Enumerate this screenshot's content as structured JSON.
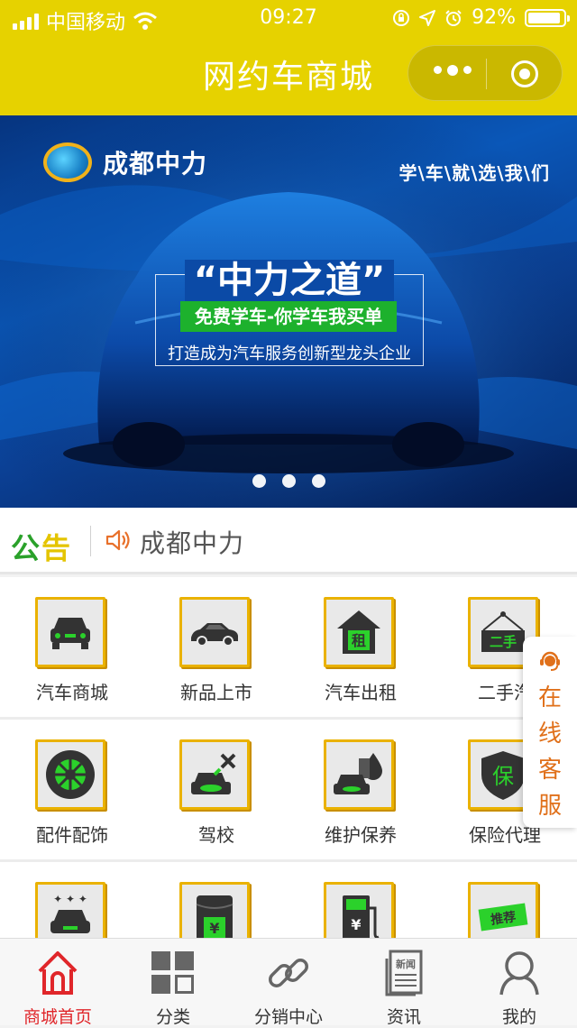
{
  "status_bar": {
    "carrier": "中国移动",
    "time": "09:27",
    "battery": "92%",
    "battery_level": 0.92
  },
  "header": {
    "title": "网约车商城",
    "more_icon": "ellipsis-icon",
    "close_icon": "target-icon"
  },
  "banner": {
    "brand": "成都中力",
    "slogan": "学\\车\\就\\选\\我\\们",
    "headline": "“中力之道”",
    "tagline": "免费学车-你学车我买单",
    "subline": "打造成为汽车服务创新型龙头企业",
    "page_count": 3,
    "active_page": 0
  },
  "notice": {
    "tag_part1": "公",
    "tag_part2": "告",
    "text": "成都中力"
  },
  "categories": [
    {
      "label": "汽车商城",
      "icon": "car-front-icon"
    },
    {
      "label": "新品上市",
      "icon": "sedan-icon"
    },
    {
      "label": "汽车出租",
      "icon": "rent-house-icon",
      "glyph": "租"
    },
    {
      "label": "二手汽",
      "icon": "secondhand-sign-icon",
      "glyph": "二手"
    },
    {
      "label": "配件配饰",
      "icon": "wheel-icon"
    },
    {
      "label": "驾校",
      "icon": "car-repair-icon"
    },
    {
      "label": "维护保养",
      "icon": "oil-drop-car-icon"
    },
    {
      "label": "保险代理",
      "icon": "shield-icon",
      "glyph": "保"
    },
    {
      "label": "",
      "icon": "car-sparkle-icon"
    },
    {
      "label": "",
      "icon": "wallet-yuan-icon",
      "glyph": "¥"
    },
    {
      "label": "",
      "icon": "fuel-pump-icon",
      "glyph": "¥"
    },
    {
      "label": "",
      "icon": "recommend-stamp-icon",
      "glyph": "推荐"
    }
  ],
  "service": {
    "text": "在线客服",
    "icon": "headset-icon",
    "color": "#e0701a"
  },
  "tabbar": [
    {
      "label": "商城首页",
      "icon": "home-icon",
      "active": true
    },
    {
      "label": "分类",
      "icon": "category-grid-icon",
      "active": false
    },
    {
      "label": "分销中心",
      "icon": "link-icon",
      "active": false
    },
    {
      "label": "资讯",
      "icon": "news-icon",
      "glyph": "新闻",
      "active": false
    },
    {
      "label": "我的",
      "icon": "user-icon",
      "active": false
    }
  ],
  "colors": {
    "brand_yellow": "#e6d200",
    "icon_border": "#eab200",
    "active_tab": "#e0262a",
    "green": "#1db12d"
  }
}
